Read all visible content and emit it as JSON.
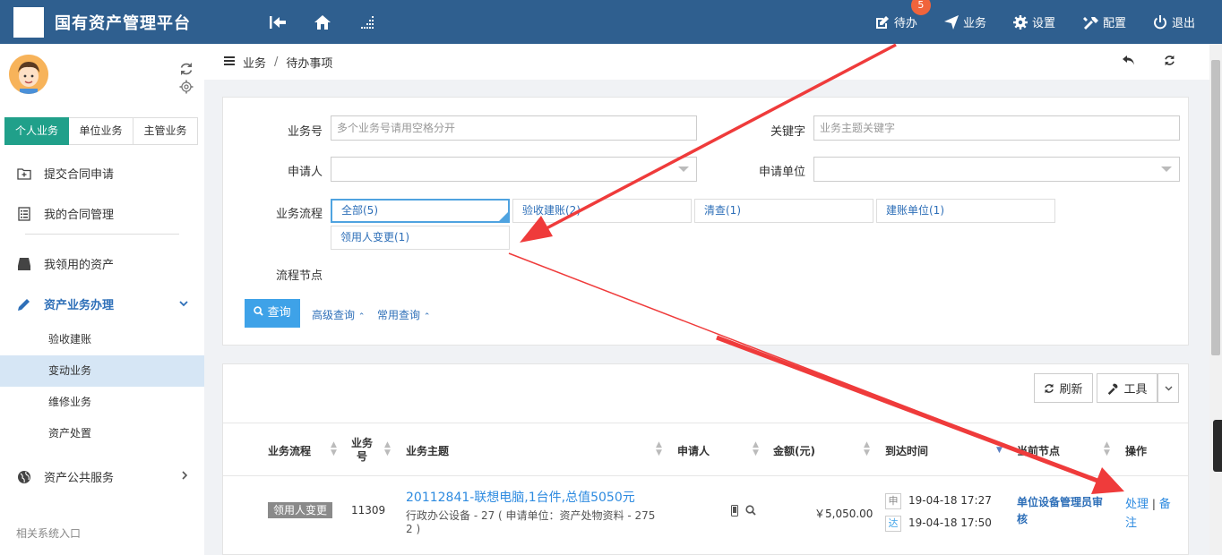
{
  "header": {
    "title": "国有资产管理平台",
    "todo_label": "待办",
    "todo_badge": "5",
    "business_label": "业务",
    "settings_label": "设置",
    "config_label": "配置",
    "logout_label": "退出"
  },
  "sidebar": {
    "tabs": [
      {
        "label": "个人业务",
        "active": true
      },
      {
        "label": "单位业务",
        "active": false
      },
      {
        "label": "主管业务",
        "active": false
      }
    ],
    "items": {
      "submit": "提交合同申请",
      "my_contract": "我的合同管理",
      "my_assets": "我领用的资产",
      "asset_business": "资产业务办理",
      "public_service": "资产公共服务"
    },
    "subitems": [
      "验收建账",
      "变动业务",
      "维修业务",
      "资产处置"
    ],
    "footer": "相关系统入口"
  },
  "breadcrumb": {
    "root": "业务",
    "sep": "/",
    "current": "待办事项"
  },
  "filter": {
    "bizno_label": "业务号",
    "bizno_placeholder": "多个业务号请用空格分开",
    "keyword_label": "关键字",
    "keyword_placeholder": "业务主题关键字",
    "applicant_label": "申请人",
    "unit_label": "申请单位",
    "flow_label": "业务流程",
    "flow_chips": [
      "全部(5)",
      "验收建账(2)",
      "清查(1)",
      "建账单位(1)",
      "领用人变更(1)"
    ],
    "node_label": "流程节点",
    "query_button": "查询",
    "advanced_link": "高级查询",
    "common_link": "常用查询"
  },
  "table": {
    "refresh_button": "刷新",
    "tools_button": "工具",
    "columns": {
      "flow": "业务流程",
      "bizno_1": "业务",
      "bizno_2": "号",
      "subject": "业务主题",
      "applicant": "申请人",
      "amount": "金额(元)",
      "arrival": "到达时间",
      "node": "当前节点",
      "ops": "操作"
    },
    "row": {
      "flow": "领用人变更",
      "bizno": "11309",
      "subject_title": "20112841-联想电脑,1台件,总值5050元",
      "subject_line2": "行政办公设备 - 27 ( 申请单位：资产处物资料 - 275",
      "subject_line3": "2 )",
      "amount": "￥5,050.00",
      "time_tag_1": "申",
      "time_1": "19-04-18 17:27",
      "time_tag_2": "达",
      "time_2": "19-04-18 17:50",
      "node_line1": "单位设备管理员审",
      "node_line2": "核",
      "op_handle": "处理",
      "op_sep": "|",
      "op_note_1": "备",
      "op_note_2": "注"
    }
  },
  "colors": {
    "header": "#2f5f8f",
    "accent": "#20a08a",
    "link": "#2e8be0",
    "badge": "#f0643c",
    "annotation": "#ef3b3b"
  }
}
